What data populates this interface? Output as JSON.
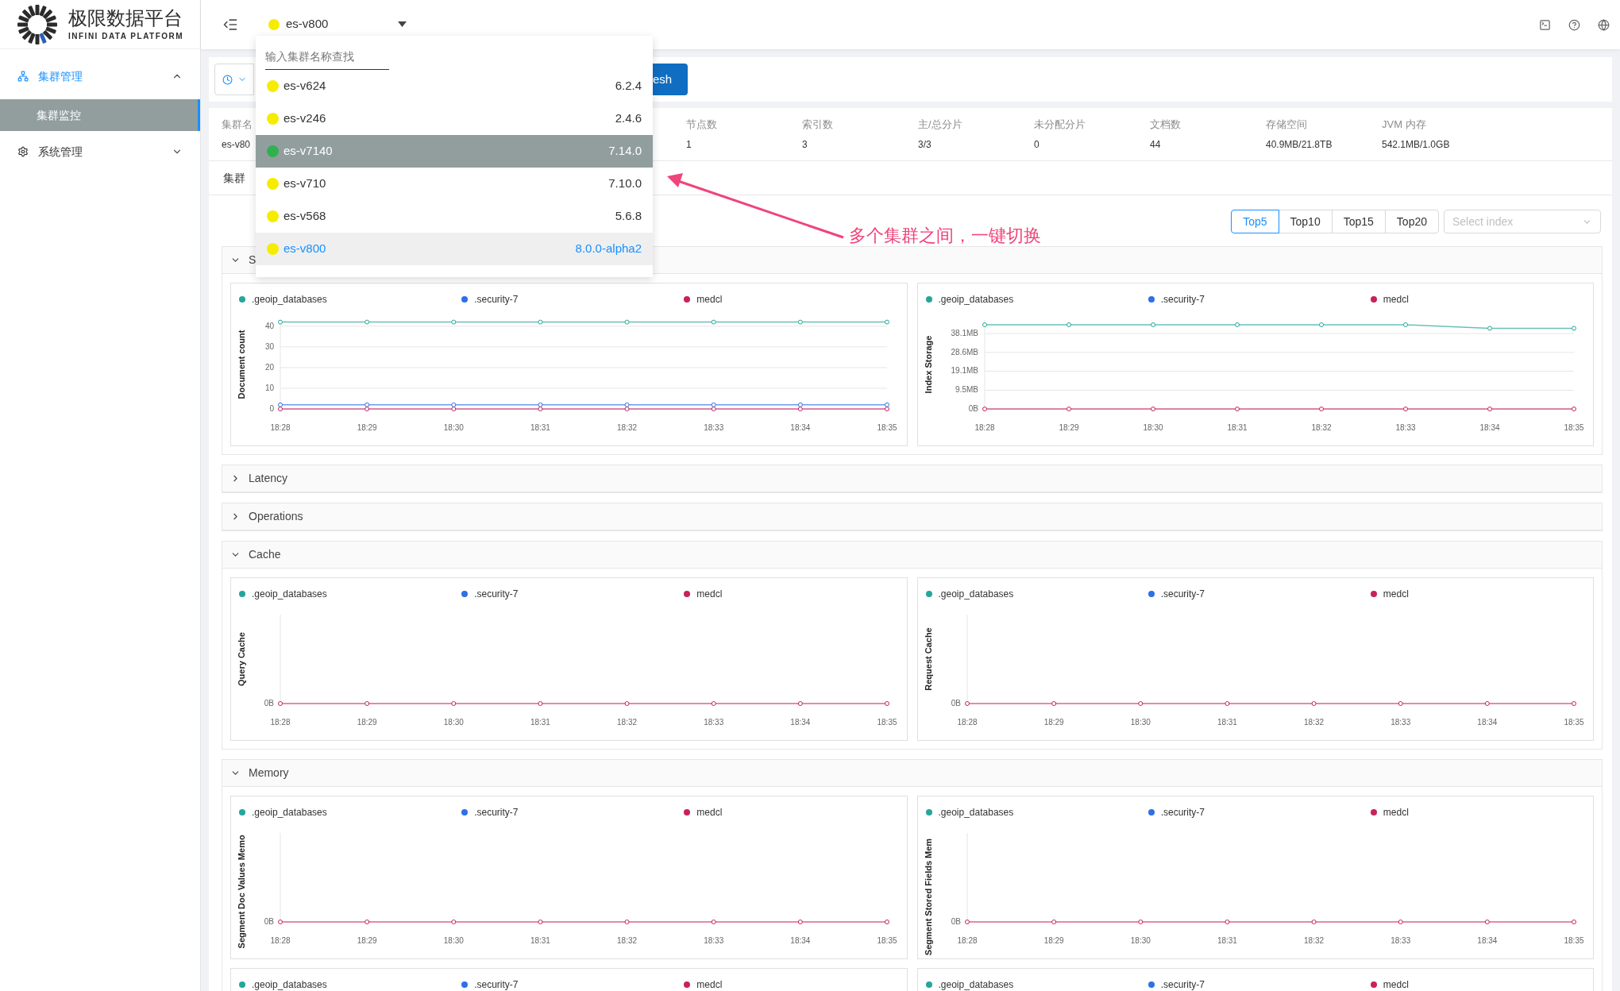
{
  "brand": {
    "title": "极限数据平台",
    "subtitle": "INFINI DATA PLATFORM"
  },
  "sidebar": {
    "items": [
      {
        "label": "集群管理",
        "selected": true,
        "expanded": true,
        "children": [
          {
            "label": "集群监控",
            "selected": true
          }
        ]
      },
      {
        "label": "系统管理",
        "selected": false,
        "expanded": false
      }
    ]
  },
  "header": {
    "cluster_select": {
      "value": "es-v800"
    }
  },
  "cluster_dropdown": {
    "search": {
      "placeholder": "输入集群名称查找"
    },
    "items": [
      {
        "name": "es-v624",
        "version": "6.2.4",
        "color": "#f5ec00",
        "selected": false,
        "highlighted": false
      },
      {
        "name": "es-v246",
        "version": "2.4.6",
        "color": "#f5ec00",
        "selected": false,
        "highlighted": false
      },
      {
        "name": "es-v7140",
        "version": "7.14.0",
        "color": "#2fb14f",
        "selected": false,
        "highlighted": true
      },
      {
        "name": "es-v710",
        "version": "7.10.0",
        "color": "#f5ec00",
        "selected": false,
        "highlighted": false
      },
      {
        "name": "es-v568",
        "version": "5.6.8",
        "color": "#f5ec00",
        "selected": false,
        "highlighted": false
      },
      {
        "name": "es-v800",
        "version": "8.0.0-alpha2",
        "color": "#f5ec00",
        "selected": true,
        "highlighted": false
      }
    ]
  },
  "toolbar": {
    "refresh_button": "esh"
  },
  "stats": [
    {
      "label": "集群名",
      "value": "es-v80"
    },
    {
      "label": "节点数",
      "value": "1"
    },
    {
      "label": "索引数",
      "value": "3"
    },
    {
      "label": "主/总分片",
      "value": "3/3"
    },
    {
      "label": "未分配分片",
      "value": "0"
    },
    {
      "label": "文档数",
      "value": "44"
    },
    {
      "label": "存储空间",
      "value": "40.9MB/21.8TB"
    },
    {
      "label": "JVM 内存",
      "value": "542.1MB/1.0GB"
    }
  ],
  "tab_label": "集群",
  "top_n": [
    {
      "label": "Top5",
      "selected": true
    },
    {
      "label": "Top10",
      "selected": false
    },
    {
      "label": "Top15",
      "selected": false
    },
    {
      "label": "Top20",
      "selected": false
    }
  ],
  "index_select": {
    "placeholder": "Select index"
  },
  "annotation": {
    "text": "多个集群之间，一键切换"
  },
  "sections": [
    {
      "title": "S",
      "expanded": true,
      "charts": [
        {
          "chart_data": {
            "type": "line",
            "ylabel": "Document count",
            "grid": true,
            "legend": true,
            "categories": [
              "18:28",
              "18:29",
              "18:30",
              "18:31",
              "18:32",
              "18:33",
              "18:34",
              "18:35"
            ],
            "ylim": [
              0,
              43
            ],
            "yticks": [
              0,
              10,
              20,
              30,
              40
            ],
            "series": [
              {
                "name": ".geoip_databases",
                "color": "#26a69a",
                "marker": "circle",
                "values": [
                  42,
                  42,
                  42,
                  42,
                  42,
                  42,
                  42,
                  42
                ]
              },
              {
                "name": ".security-7",
                "color": "#2f6fe8",
                "marker": "circle",
                "values": [
                  2,
                  2,
                  2,
                  2,
                  2,
                  2,
                  2,
                  2
                ]
              },
              {
                "name": "medcl",
                "color": "#c8215c",
                "marker": "circle",
                "values": [
                  0,
                  0,
                  0,
                  0,
                  0,
                  0,
                  0,
                  0
                ]
              }
            ]
          }
        },
        {
          "chart_data": {
            "type": "line",
            "ylabel": "Index Storage",
            "grid": true,
            "legend": true,
            "categories": [
              "18:28",
              "18:29",
              "18:30",
              "18:31",
              "18:32",
              "18:33",
              "18:34",
              "18:35"
            ],
            "ylim": [
              0,
              45
            ],
            "yticks": [
              {
                "value": 0,
                "label": "0B"
              },
              {
                "value": 9.5,
                "label": "9.5MB"
              },
              {
                "value": 19.1,
                "label": "19.1MB"
              },
              {
                "value": 28.6,
                "label": "28.6MB"
              },
              {
                "value": 38.1,
                "label": "38.1MB"
              }
            ],
            "series": [
              {
                "name": ".geoip_databases",
                "color": "#26a69a",
                "marker": "circle",
                "values": [
                  42.6,
                  42.6,
                  42.6,
                  42.6,
                  42.6,
                  42.6,
                  40.8,
                  40.8
                ]
              },
              {
                "name": ".security-7",
                "color": "#2f6fe8",
                "marker": "circle",
                "values": [
                  null,
                  null,
                  null,
                  null,
                  null,
                  null,
                  null,
                  null
                ]
              },
              {
                "name": "medcl",
                "color": "#c8215c",
                "marker": "circle",
                "values": [
                  0,
                  0,
                  0,
                  0,
                  0,
                  0,
                  0,
                  0
                ]
              }
            ]
          }
        }
      ]
    },
    {
      "title": "Latency",
      "expanded": false
    },
    {
      "title": "Operations",
      "expanded": false
    },
    {
      "title": "Cache",
      "expanded": true,
      "charts": [
        {
          "legend": [
            {
              "name": ".geoip_databases",
              "color": "#26a69a"
            },
            {
              "name": ".security-7",
              "color": "#2f6fe8"
            },
            {
              "name": "medcl",
              "color": "#c8215c"
            }
          ],
          "axis": {
            "ylabel": "Query Cache",
            "ytick": "0B",
            "xlabels": [
              "18:28",
              "18:29",
              "18:30",
              "18:31",
              "18:32",
              "18:33",
              "18:34",
              "18:35"
            ]
          }
        },
        {
          "legend": [
            {
              "name": ".geoip_databases",
              "color": "#26a69a"
            },
            {
              "name": ".security-7",
              "color": "#2f6fe8"
            },
            {
              "name": "medcl",
              "color": "#c8215c"
            }
          ],
          "axis": {
            "ylabel": "Request Cache",
            "ytick": "0B",
            "xlabels": [
              "18:28",
              "18:29",
              "18:30",
              "18:31",
              "18:32",
              "18:33",
              "18:34",
              "18:35"
            ]
          }
        }
      ]
    },
    {
      "title": "Memory",
      "expanded": true,
      "charts": [
        {
          "legend": [
            {
              "name": ".geoip_databases",
              "color": "#26a69a"
            },
            {
              "name": ".security-7",
              "color": "#2f6fe8"
            },
            {
              "name": "medcl",
              "color": "#c8215c"
            }
          ],
          "axis": {
            "ylabel": "Segment Doc Values Memo",
            "ytick": "0B",
            "xlabels": [
              "18:28",
              "18:29",
              "18:30",
              "18:31",
              "18:32",
              "18:33",
              "18:34",
              "18:35"
            ]
          }
        },
        {
          "legend": [
            {
              "name": ".geoip_databases",
              "color": "#26a69a"
            },
            {
              "name": ".security-7",
              "color": "#2f6fe8"
            },
            {
              "name": "medcl",
              "color": "#c8215c"
            }
          ],
          "axis": {
            "ylabel": "Segment Stored Fields Mem",
            "ytick": "0B",
            "xlabels": [
              "18:28",
              "18:29",
              "18:30",
              "18:31",
              "18:32",
              "18:33",
              "18:34",
              "18:35"
            ]
          }
        },
        {
          "legend": [
            {
              "name": ".geoip_databases",
              "color": "#26a69a"
            },
            {
              "name": ".security-7",
              "color": "#2f6fe8"
            },
            {
              "name": "medcl",
              "color": "#c8215c"
            }
          ]
        },
        {
          "legend": [
            {
              "name": ".geoip_databases",
              "color": "#26a69a"
            },
            {
              "name": ".security-7",
              "color": "#2f6fe8"
            },
            {
              "name": "medcl",
              "color": "#c8215c"
            }
          ]
        }
      ]
    }
  ]
}
